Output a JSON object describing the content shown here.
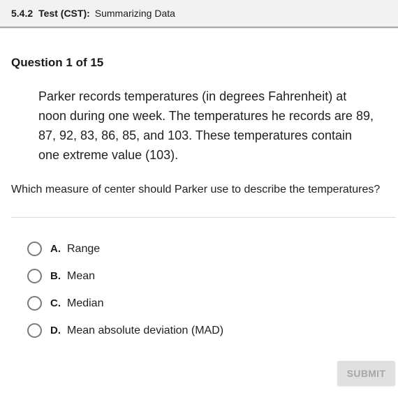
{
  "header": {
    "code": "5.4.2",
    "test_label": "Test (CST):",
    "title": "Summarizing Data"
  },
  "question": {
    "number_label": "Question 1 of 15",
    "passage": "Parker records temperatures (in degrees Fahrenheit) at noon during one week. The temperatures he records are 89, 87, 92, 83, 86, 85, and 103. These temperatures contain one extreme value (103).",
    "prompt": "Which measure of center should Parker use to describe the temperatures?"
  },
  "options": [
    {
      "letter": "A.",
      "text": "Range",
      "selected": false
    },
    {
      "letter": "B.",
      "text": "Mean",
      "selected": false
    },
    {
      "letter": "C.",
      "text": "Median",
      "selected": false
    },
    {
      "letter": "D.",
      "text": "Mean absolute deviation (MAD)",
      "selected": false
    }
  ],
  "submit": {
    "label": "SUBMIT",
    "enabled": false
  }
}
